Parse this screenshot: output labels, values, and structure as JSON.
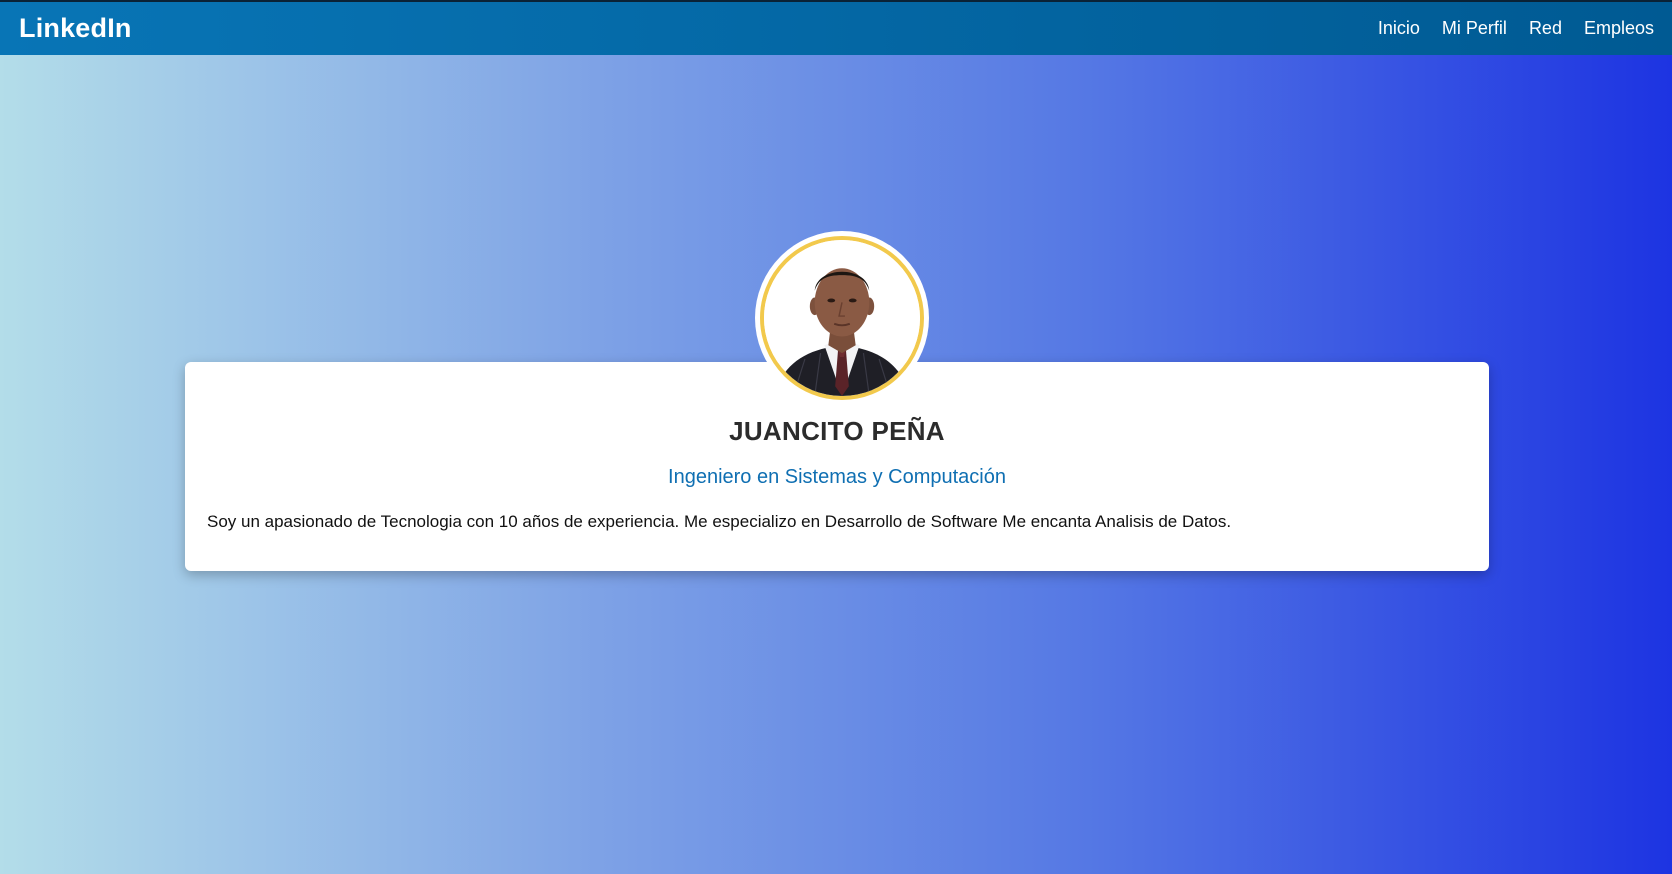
{
  "header": {
    "brand": "LinkedIn",
    "nav": [
      {
        "label": "Inicio"
      },
      {
        "label": "Mi Perfil"
      },
      {
        "label": "Red"
      },
      {
        "label": "Empleos"
      }
    ]
  },
  "profile": {
    "name": "JUANCITO PEÑA",
    "headline": "Ingeniero en Sistemas y Computación",
    "about": "Soy un apasionado de Tecnologia con 10 años de experiencia. Me especializo en Desarrollo de Software Me encanta Analisis de Datos.",
    "avatar_icon": "profile-photo"
  },
  "colors": {
    "header_bg": "#0a6aa8",
    "headline": "#0f6fb2",
    "avatar_ring": "#f2c94c",
    "gradient_start": "#b3dde9",
    "gradient_end": "#1d34e2"
  }
}
